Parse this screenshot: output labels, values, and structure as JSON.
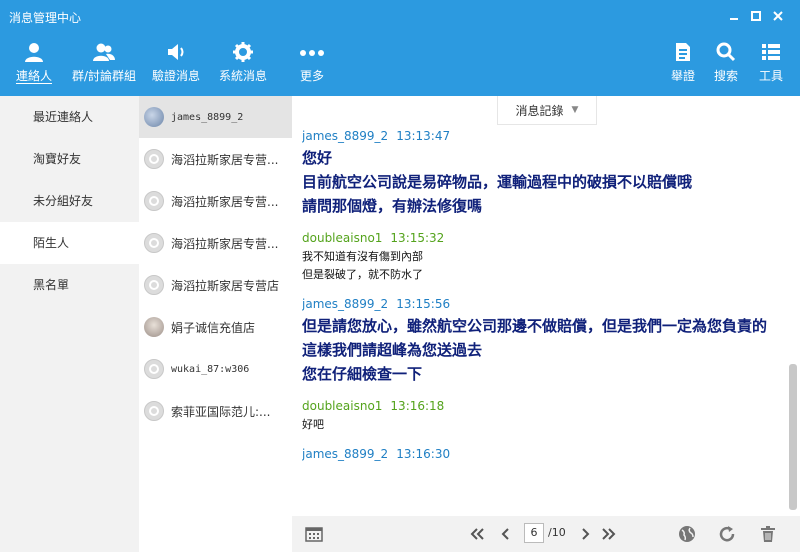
{
  "window": {
    "title": "消息管理中心"
  },
  "nav": {
    "contacts": "連絡人",
    "groups": "群/討論群組",
    "verify": "驗證消息",
    "system": "系統消息",
    "more": "更多",
    "report": "舉證",
    "search": "搜索",
    "tools": "工具"
  },
  "categories": [
    {
      "label": "最近連絡人"
    },
    {
      "label": "淘寶好友"
    },
    {
      "label": "未分組好友"
    },
    {
      "label": "陌生人"
    },
    {
      "label": "黑名單"
    }
  ],
  "contacts": [
    {
      "name": "james_8899_2"
    },
    {
      "name": "海滔拉斯家居专营..."
    },
    {
      "name": "海滔拉斯家居专营..."
    },
    {
      "name": "海滔拉斯家居专营..."
    },
    {
      "name": "海滔拉斯家居专营店"
    },
    {
      "name": "娟子诚信充值店"
    },
    {
      "name": "wukai_87:w306"
    },
    {
      "name": "索菲亚国际范儿:..."
    }
  ],
  "record_dropdown": "消息記錄",
  "messages": [
    {
      "sender": "james_8899_2",
      "time": "13:13:47",
      "lines": [
        "您好",
        "目前航空公司說是易碎物品，運輸過程中的破損不以賠償哦",
        "請問那個燈，有辦法修復嗎"
      ]
    },
    {
      "sender": "doubleaisno1",
      "time": "13:15:32",
      "lines": [
        "我不知道有沒有傷到內部",
        "但是裂破了，就不防水了"
      ]
    },
    {
      "sender": "james_8899_2",
      "time": "13:15:56",
      "lines": [
        "但是請您放心，雖然航空公司那邊不做賠償，但是我們一定為您負責的",
        "這樣我們請超峰為您送過去",
        "您在仔細檢查一下"
      ]
    },
    {
      "sender": "doubleaisno1",
      "time": "13:16:18",
      "lines": [
        "好吧"
      ]
    },
    {
      "sender": "james_8899_2",
      "time": "13:16:30",
      "lines": []
    }
  ],
  "pager": {
    "current": "6",
    "total": "/10"
  }
}
